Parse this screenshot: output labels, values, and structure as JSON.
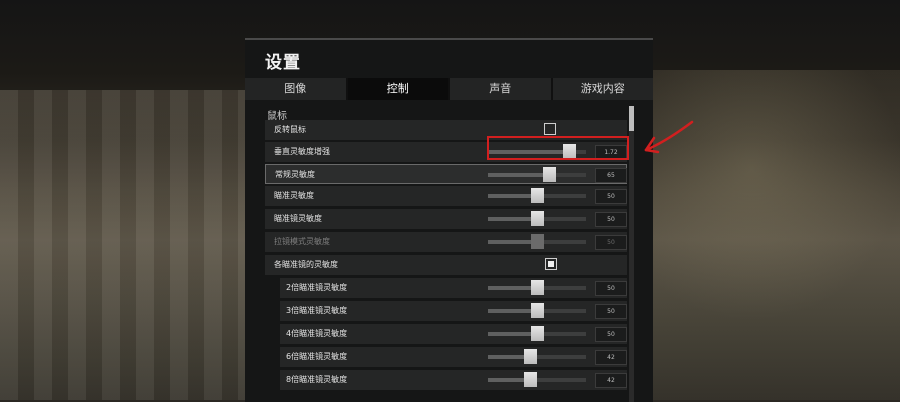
{
  "title": "设置",
  "tabs": [
    {
      "label": "图像",
      "active": false
    },
    {
      "label": "控制",
      "active": true
    },
    {
      "label": "声音",
      "active": false
    },
    {
      "label": "游戏内容",
      "active": false
    }
  ],
  "section": "鼠标",
  "rows": {
    "invert_mouse": {
      "label": "反转鼠标",
      "checked": false
    },
    "vertical_boost": {
      "label": "垂直灵敏度增强",
      "value": "1.72",
      "fraction": 0.88
    },
    "general_sens": {
      "label": "常规灵敏度",
      "value": "65",
      "fraction": 0.65
    },
    "aim_sens": {
      "label": "瞄准灵敏度",
      "value": "50",
      "fraction": 0.5
    },
    "scope_sens": {
      "label": "瞄准镜灵敏度",
      "value": "50",
      "fraction": 0.5
    },
    "toggle_scope_sens": {
      "label": "拉镜模式灵敏度",
      "value": "50",
      "fraction": 0.5,
      "disabled": true
    },
    "per_scope": {
      "label": "各瞄准镜的灵敏度",
      "checked": true
    },
    "scope_2x": {
      "label": "2倍瞄准镜灵敏度",
      "value": "50",
      "fraction": 0.5
    },
    "scope_3x": {
      "label": "3倍瞄准镜灵敏度",
      "value": "50",
      "fraction": 0.5
    },
    "scope_4x": {
      "label": "4倍瞄准镜灵敏度",
      "value": "50",
      "fraction": 0.5
    },
    "scope_6x": {
      "label": "6倍瞄准镜灵敏度",
      "value": "42",
      "fraction": 0.42
    },
    "scope_8x": {
      "label": "8倍瞄准镜灵敏度",
      "value": "42",
      "fraction": 0.42
    }
  },
  "colors": {
    "highlight": "#d21f1f",
    "panel": "#151616",
    "row": "#252626"
  }
}
